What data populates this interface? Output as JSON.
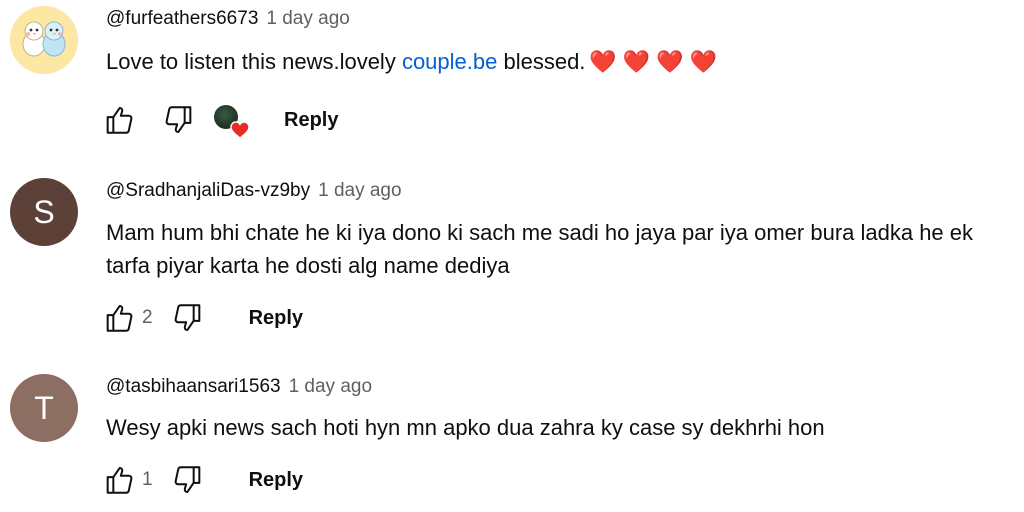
{
  "comments": [
    {
      "author": "@furfeathers6673",
      "time": "1 day ago",
      "text_before": "Love to listen this news.lovely ",
      "link": "couple.be",
      "text_after": " blessed.",
      "hearts": "❤️❤️❤️❤️",
      "likes": "",
      "reply": "Reply",
      "avatar_type": "image",
      "creator_heart": true
    },
    {
      "author": "@SradhanjaliDas-vz9by",
      "time": "1 day ago",
      "text": "Mam hum bhi chate he ki iya dono ki sach me sadi ho jaya par iya omer bura ladka he ek tarfa piyar karta he dosti alg name dediya",
      "likes": "2",
      "reply": "Reply",
      "avatar_letter": "S",
      "avatar_color": "#5d4037"
    },
    {
      "author": "@tasbihaansari1563",
      "time": "1 day ago",
      "text": "Wesy apki news sach hoti hyn mn apko dua zahra ky case sy dekhrhi hon",
      "likes": "1",
      "reply": "Reply",
      "avatar_letter": "T",
      "avatar_color": "#8d6e63"
    }
  ],
  "colors": {
    "link": "#065fd4",
    "secondary_text": "#606060",
    "heart": "#e52d27"
  },
  "icons": [
    "thumb-up-icon",
    "thumb-down-icon",
    "creator-heart-icon"
  ]
}
